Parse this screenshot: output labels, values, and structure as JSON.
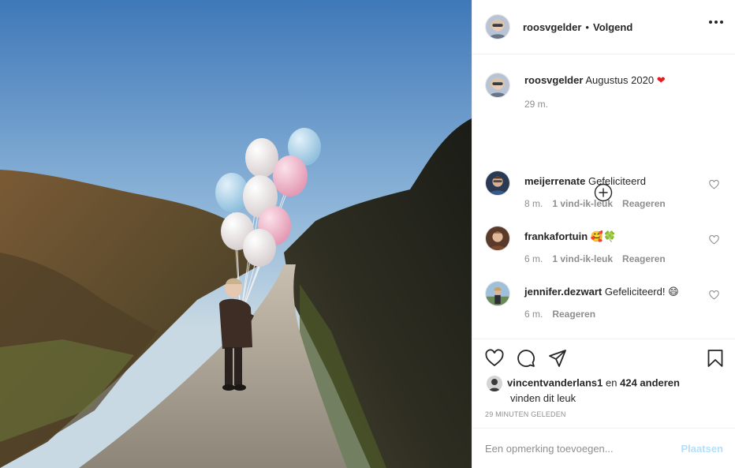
{
  "colors": {
    "accent": "#0095f6",
    "accent_disabled": "#b2dffc",
    "text": "#262626",
    "muted": "#8e8e8e",
    "border": "#efefef",
    "heart_red": "#e31b23"
  },
  "header": {
    "username": "roosvgelder",
    "separator": "•",
    "follow_status": "Volgend",
    "more_icon": "more-horizontal-icon"
  },
  "caption": {
    "username": "roosvgelder",
    "text": "Augustus 2020",
    "emoji": "❤",
    "time": "29 m."
  },
  "comments": [
    {
      "username": "meijerrenate",
      "text": "Gefeliciteerd",
      "time": "8 m.",
      "likes": "1 vind-ik-leuk",
      "reply": "Reageren"
    },
    {
      "username": "frankafortuin",
      "text": "🥰🍀",
      "time": "6 m.",
      "likes": "1 vind-ik-leuk",
      "reply": "Reageren"
    },
    {
      "username": "jennifer.dezwart",
      "text": "Gefeliciteerd! 😄",
      "time": "6 m.",
      "likes": "",
      "reply": "Reageren"
    }
  ],
  "likes": {
    "user": "vincentvanderlans1",
    "connector": "en",
    "others": "424 anderen",
    "suffix": "vinden dit leuk"
  },
  "timestamp": "29 MINUTEN GELEDEN",
  "add_comment": {
    "placeholder": "Een opmerking toevoegen...",
    "post_label": "Plaatsen"
  }
}
